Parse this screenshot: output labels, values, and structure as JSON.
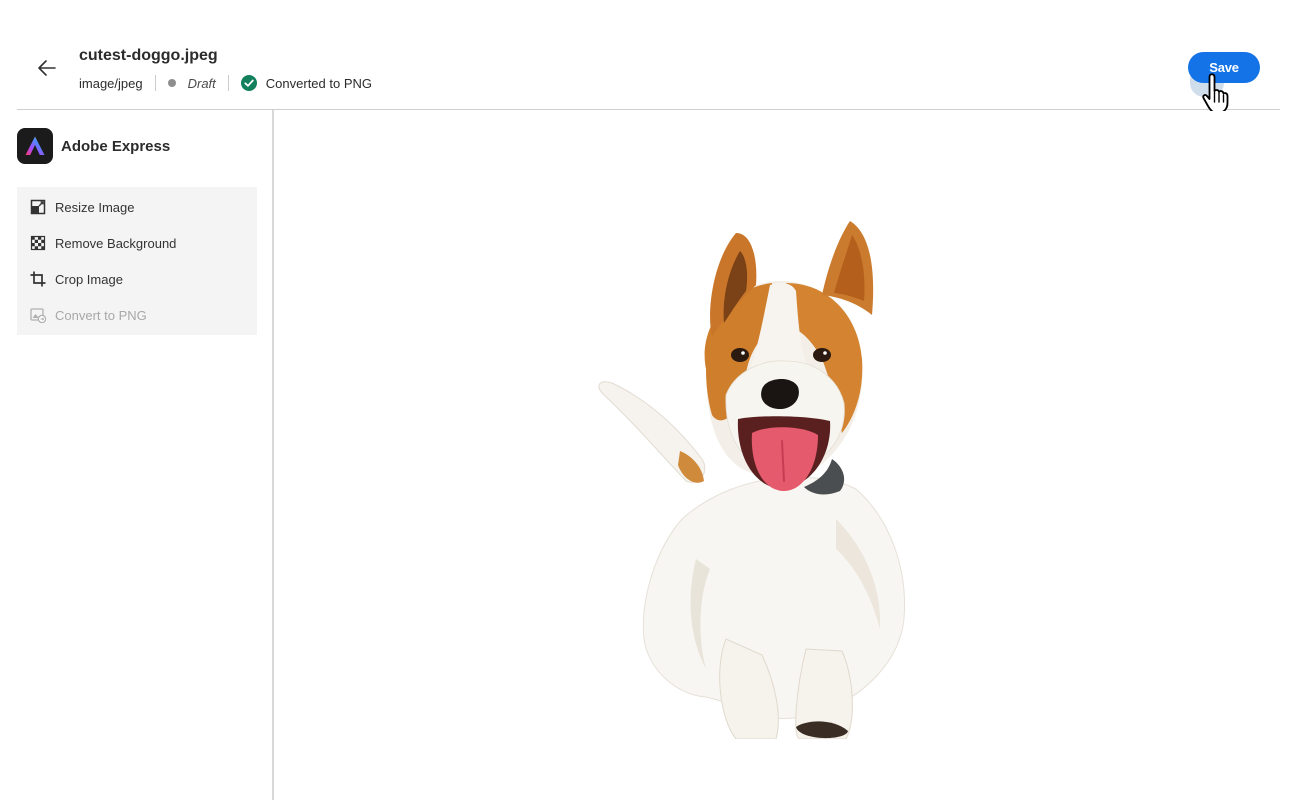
{
  "header": {
    "file_name": "cutest-doggo.jpeg",
    "mime_type": "image/jpeg",
    "status": "Draft",
    "conversion_status": "Converted to PNG",
    "save_label": "Save"
  },
  "sidebar": {
    "brand_name": "Adobe Express",
    "tools": [
      {
        "label": "Resize Image",
        "icon": "resize-icon",
        "enabled": true
      },
      {
        "label": "Remove Background",
        "icon": "checkerboard-icon",
        "enabled": true
      },
      {
        "label": "Crop Image",
        "icon": "crop-icon",
        "enabled": true
      },
      {
        "label": "Convert to PNG",
        "icon": "convert-image-icon",
        "enabled": false
      }
    ]
  },
  "colors": {
    "accent": "#1473e6",
    "success": "#12805c",
    "draft_dot": "#8e8e8e"
  }
}
